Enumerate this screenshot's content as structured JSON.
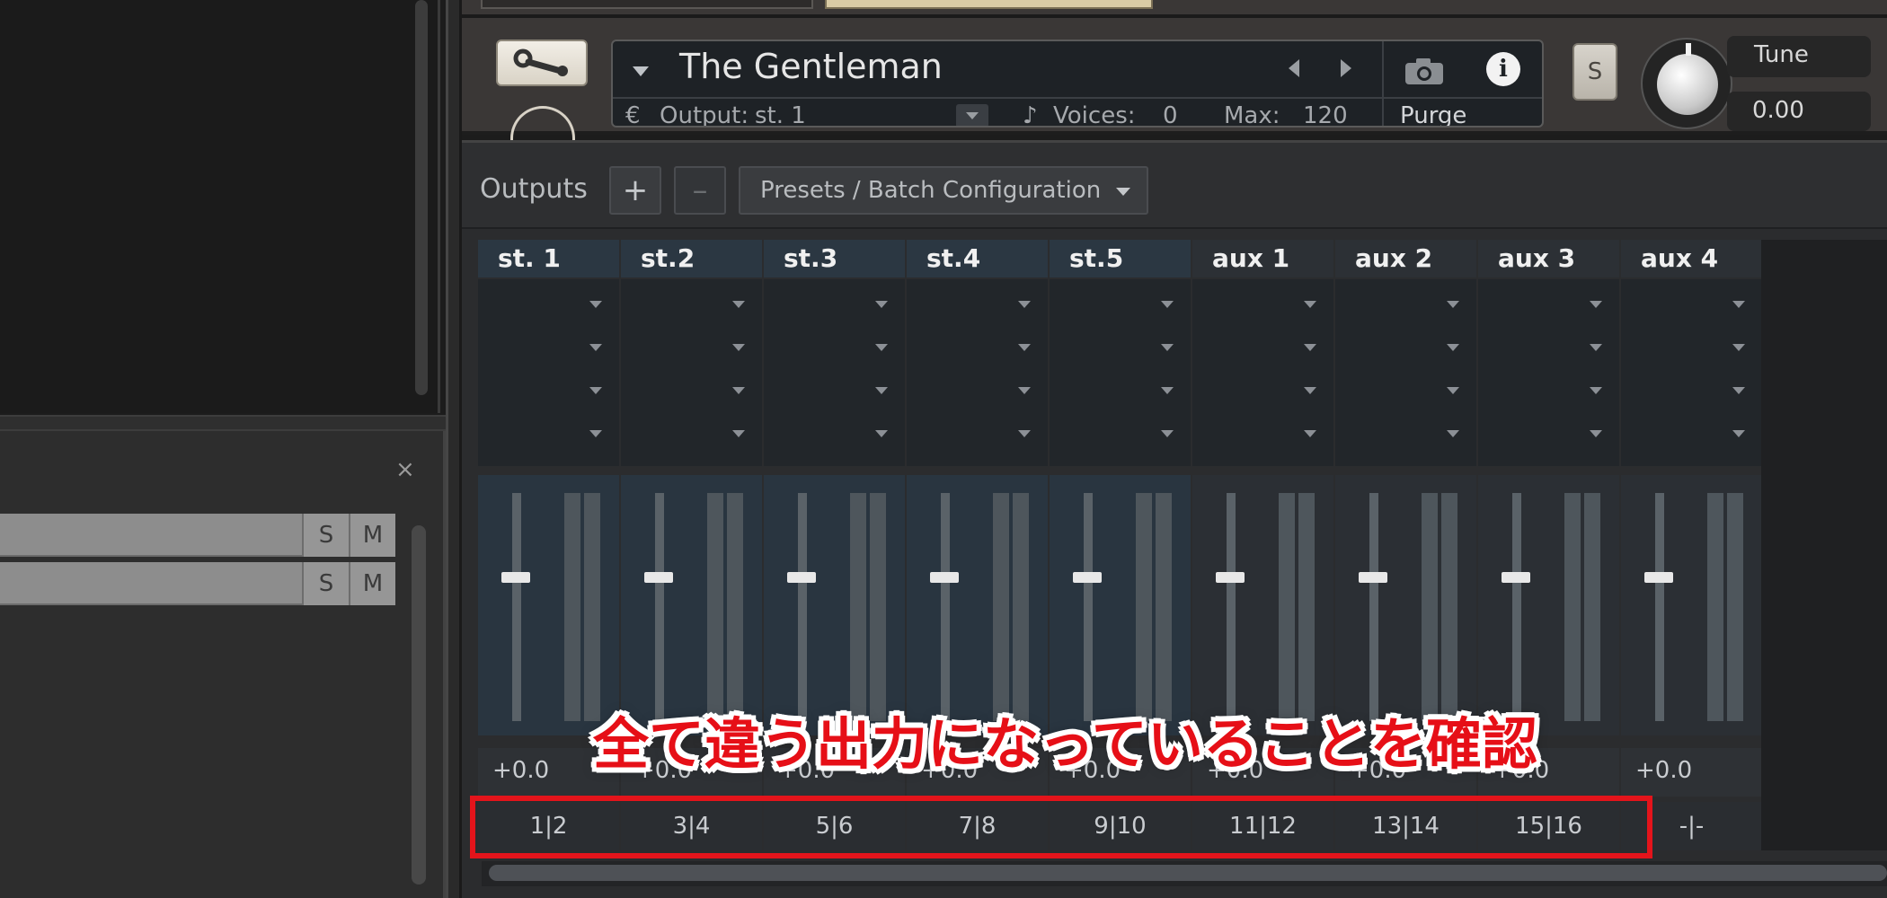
{
  "instrument": {
    "name": "The Gentleman",
    "output_label": "Output:",
    "output_value": "st. 1",
    "voices_label": "Voices:",
    "voices_value": "0",
    "max_label": "Max:",
    "max_value": "120",
    "purge_label": "Purge",
    "solo_label": "S",
    "tune_label": "Tune",
    "tune_value": "0.00"
  },
  "left_panel": {
    "close_label": "×",
    "tracks": [
      {
        "solo": "S",
        "mute": "M"
      },
      {
        "solo": "S",
        "mute": "M"
      }
    ]
  },
  "outputs": {
    "title": "Outputs",
    "add_label": "+",
    "remove_label": "–",
    "presets_label": "Presets / Batch Configuration",
    "channels": [
      {
        "name": "st. 1",
        "volume": "+0.0",
        "route": "1|2",
        "type": "stereo"
      },
      {
        "name": "st.2",
        "volume": "+0.0",
        "route": "3|4",
        "type": "stereo"
      },
      {
        "name": "st.3",
        "volume": "+0.0",
        "route": "5|6",
        "type": "stereo"
      },
      {
        "name": "st.4",
        "volume": "+0.0",
        "route": "7|8",
        "type": "stereo"
      },
      {
        "name": "st.5",
        "volume": "+0.0",
        "route": "9|10",
        "type": "stereo"
      },
      {
        "name": "aux 1",
        "volume": "+0.0",
        "route": "11|12",
        "type": "aux"
      },
      {
        "name": "aux 2",
        "volume": "+0.0",
        "route": "13|14",
        "type": "aux"
      },
      {
        "name": "aux 3",
        "volume": "+0.0",
        "route": "15|16",
        "type": "aux"
      },
      {
        "name": "aux 4",
        "volume": "+0.0",
        "route": "-|-",
        "type": "aux"
      }
    ]
  },
  "annotation": {
    "text": "全て違う出力になっていることを確認",
    "color": "#e4141b"
  },
  "colors": {
    "stereo_header": "#2b3742",
    "panel_bg": "#2b2c2e",
    "fader_handle": "#e8e8e8"
  }
}
